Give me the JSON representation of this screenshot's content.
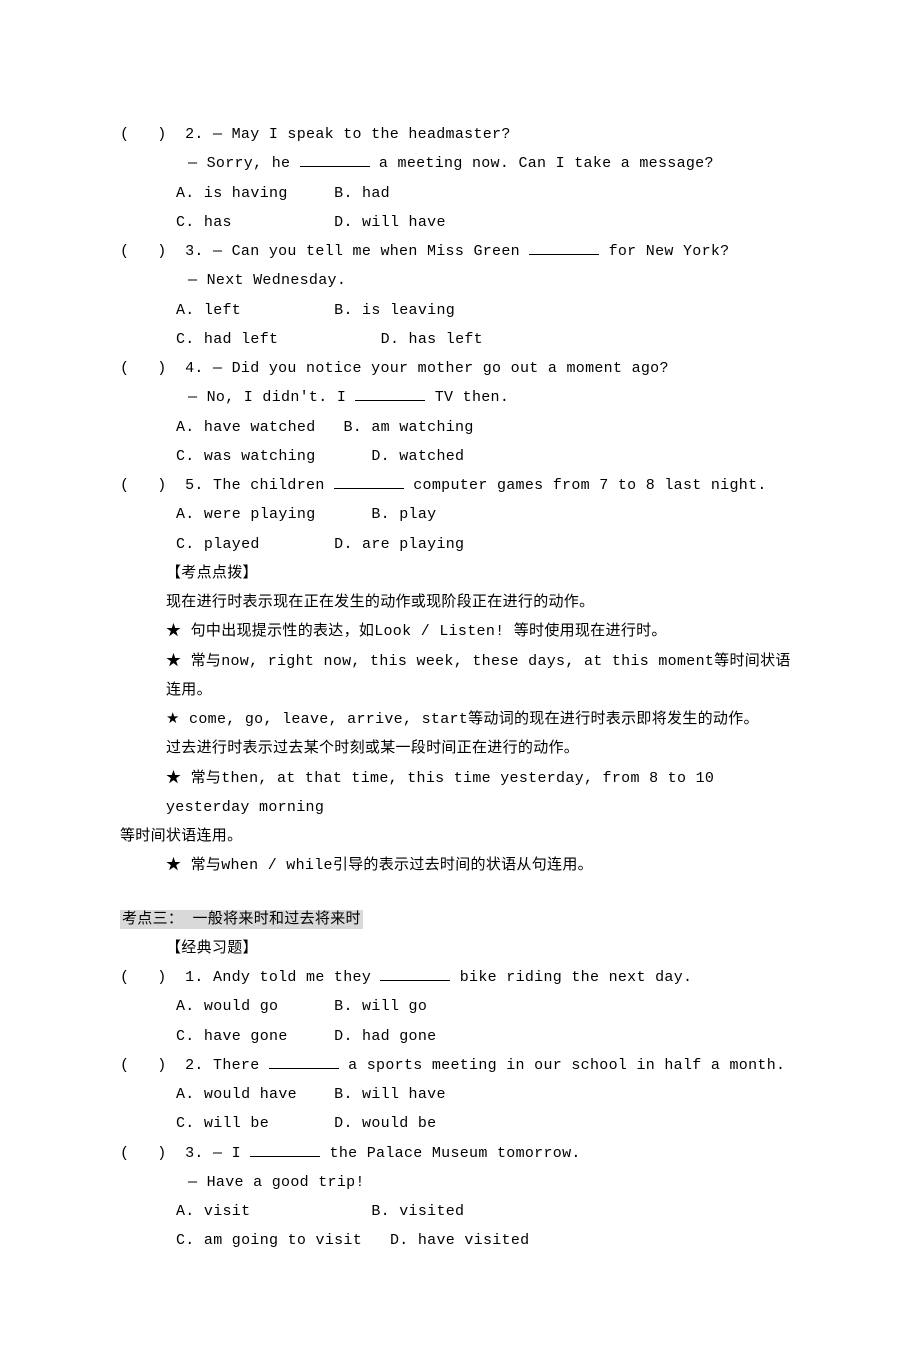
{
  "q2": {
    "head": "(   )  2. — May I speak to the headmaster?",
    "line2_a": "— Sorry, he ",
    "line2_b": " a meeting now. Can I take a message?",
    "optA": "A. is having",
    "optB": "B. had",
    "optC": "C. has",
    "optD": "D. will have"
  },
  "q3": {
    "head_a": "(   )  3. — Can you tell me when Miss Green ",
    "head_b": " for New York?",
    "line2": "— Next Wednesday.",
    "optA": "A. left",
    "optB": "B. is leaving",
    "optC": "C. had left",
    "optD": "D. has left"
  },
  "q4": {
    "head": "(   )  4. — Did you notice your mother go out a moment ago?",
    "line2_a": "— No, I didn't. I ",
    "line2_b": " TV then.",
    "optA": "A. have watched",
    "optB": "B. am watching",
    "optC": "C. was watching",
    "optD": "D. watched"
  },
  "q5": {
    "head_a": "(   )  5. The children ",
    "head_b": " computer games from 7 to 8 last night.",
    "optA": "A. were playing",
    "optB": "B. play",
    "optC": "C. played",
    "optD": "D. are playing"
  },
  "tips": {
    "title": "【考点点拨】",
    "p1": "现在进行时表示现在正在发生的动作或现阶段正在进行的动作。",
    "p2": "★ 句中出现提示性的表达，如Look / Listen! 等时使用现在进行时。",
    "p3": "★ 常与now, right now, this week, these days, at this moment等时间状语连用。",
    "p4": "★ come, go, leave, arrive, start等动词的现在进行时表示即将发生的动作。",
    "p5": "过去进行时表示过去某个时刻或某一段时间正在进行的动作。",
    "p6a": "★ 常与then, at that time, this time yesterday, from 8 to 10 yesterday morning",
    "p6b": "等时间状语连用。",
    "p7": "★ 常与when / while引导的表示过去时间的状语从句连用。"
  },
  "sec3": {
    "title": "考点三： 一般将来时和过去将来时",
    "sub": "【经典习题】"
  },
  "s3q1": {
    "head_a": "(   )  1. Andy told me they ",
    "head_b": " bike riding the next day.",
    "optA": "A. would go",
    "optB": "B. will go",
    "optC": "C. have gone",
    "optD": "D. had gone"
  },
  "s3q2": {
    "head_a": "(   )  2. There ",
    "head_b": " a sports meeting in our school in half a month.",
    "optA": "A. would have",
    "optB": "B. will have",
    "optC": "C. will be",
    "optD": "D. would be"
  },
  "s3q3": {
    "head_a": "(   )  3. — I ",
    "head_b": " the Palace Museum tomorrow.",
    "line2": "— Have a good trip!",
    "optA": "A. visit",
    "optB": "B. visited",
    "optC": "C. am going to visit",
    "optD": "D. have visited"
  }
}
